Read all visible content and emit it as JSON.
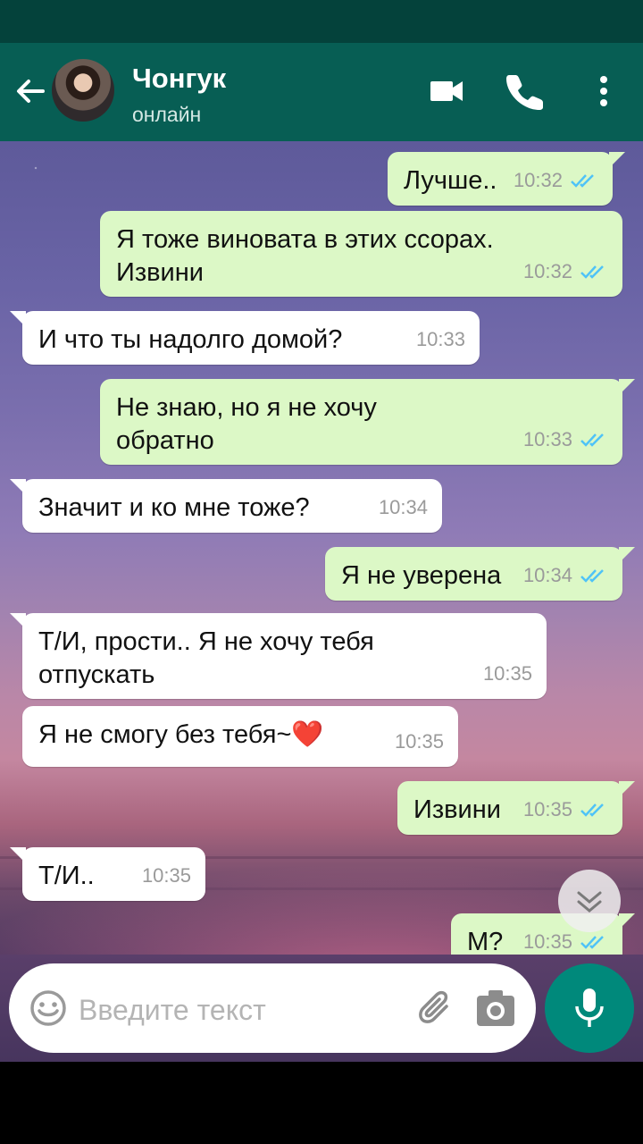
{
  "contact": {
    "name": "Чонгук",
    "status": "онлайн"
  },
  "messages": [
    {
      "dir": "out",
      "text": "Лучше..",
      "time": "10:32",
      "read": true
    },
    {
      "dir": "out",
      "text": "Я тоже виновата в этих ссорах.\nИзвини",
      "time": "10:32",
      "read": true
    },
    {
      "dir": "in",
      "text": "И что ты надолго домой?",
      "time": "10:33"
    },
    {
      "dir": "out",
      "text": "Не знаю, но я не хочу\nобратно",
      "time": "10:33",
      "read": true
    },
    {
      "dir": "in",
      "text": "Значит и ко мне тоже?",
      "time": "10:34"
    },
    {
      "dir": "out",
      "text": "Я не уверена",
      "time": "10:34",
      "read": true
    },
    {
      "dir": "in",
      "text": "Т/И, прости.. Я не хочу тебя\nотпускать",
      "time": "10:35"
    },
    {
      "dir": "in",
      "text": "Я не смогу без тебя~❤️",
      "time": "10:35"
    },
    {
      "dir": "out",
      "text": "Извини",
      "time": "10:35",
      "read": true
    },
    {
      "dir": "in",
      "text": "Т/И..",
      "time": "10:35"
    },
    {
      "dir": "out",
      "text": "М?",
      "time": "10:35",
      "read": true
    }
  ],
  "composer": {
    "placeholder": "Введите текст"
  },
  "icons": {
    "back": "arrow-left-icon",
    "video": "videocam-icon",
    "call": "phone-icon",
    "menu": "more-vert-icon",
    "emoji": "emoji-icon",
    "attach": "paperclip-icon",
    "camera": "camera-icon",
    "mic": "mic-icon",
    "scroll": "chevron-double-down-icon",
    "read": "double-check-icon"
  },
  "colors": {
    "header": "#075e54",
    "outgoing": "#dcf8c6",
    "incoming": "#ffffff",
    "accent": "#00897b",
    "read_ticks": "#4fc3f7"
  }
}
